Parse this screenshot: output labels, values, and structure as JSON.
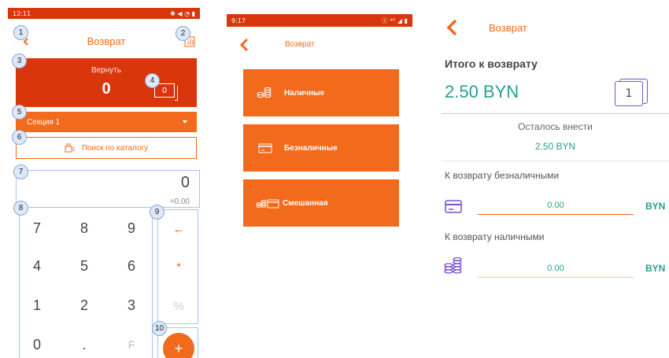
{
  "screen1": {
    "status": {
      "time": "12:11",
      "icons": "✱ ◀ ◔ ▮"
    },
    "title": "Возврат",
    "return_label": "Вернуть",
    "return_value": "0",
    "qty_value": "0",
    "section_label": "Секция 1",
    "catalog_label": "Поиск по каталогу",
    "display": {
      "value": "0",
      "sub": "=0.00"
    },
    "keys": [
      "7",
      "8",
      "9",
      "4",
      "5",
      "6",
      "1",
      "2",
      "3",
      "0",
      ".",
      "F"
    ],
    "ops": [
      "←",
      "*",
      "%"
    ],
    "plus_label": "+",
    "badges": [
      "1",
      "2",
      "3",
      "4",
      "5",
      "6",
      "7",
      "8",
      "9",
      "10"
    ]
  },
  "screen2": {
    "status": {
      "time": "9:17",
      "icons": "ⓩ ⁴ᴳ ◢ ▮"
    },
    "title": "Возврат",
    "payments": [
      {
        "label": "Наличные",
        "icon": "coins-icon"
      },
      {
        "label": "Безналичные",
        "icon": "card-icon"
      },
      {
        "label": "Смешанная",
        "icon": "mixed-icon"
      }
    ]
  },
  "screen3": {
    "title": "Возврат",
    "total_label": "Итого к возврату",
    "total_value": "2.50 BYN",
    "count": "1",
    "remain_label": "Осталось внести",
    "remain_value": "2.50 BYN",
    "cashless_label": "К возврату безналичными",
    "cashless_value": "0.00",
    "cash_label": "К возврату наличными",
    "cash_value": "0.00",
    "currency": "BYN"
  },
  "colors": {
    "accent": "#f26a1b",
    "dark_accent": "#d9360b",
    "teal": "#2a9d8f",
    "purple": "#7b4fd1",
    "annotation": "#a8c3ee"
  }
}
